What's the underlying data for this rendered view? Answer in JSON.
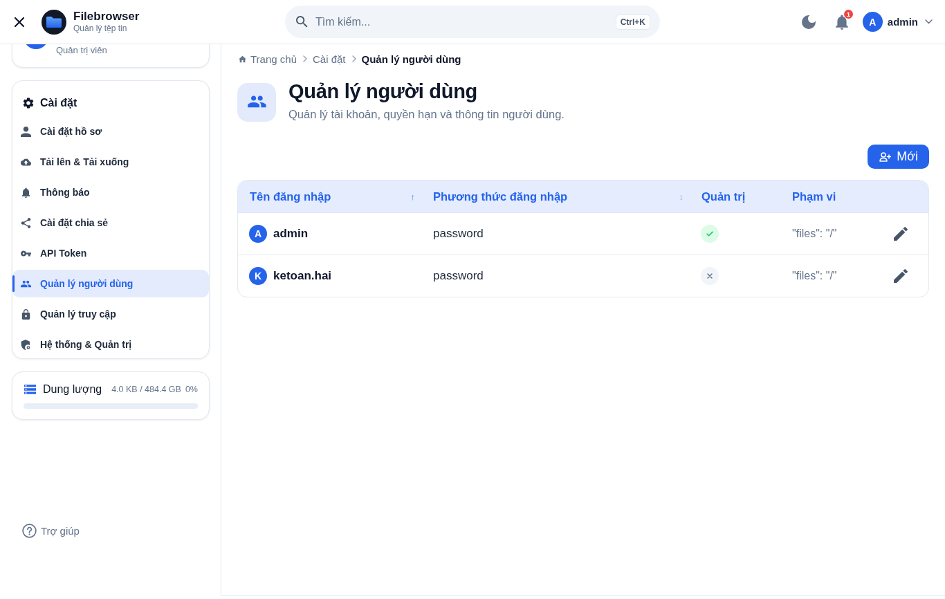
{
  "header": {
    "brand": {
      "name": "Filebrowser",
      "tagline": "Quản lý tệp tin"
    },
    "search": {
      "placeholder": "Tìm kiếm...",
      "shortcut": "Ctrl+K"
    },
    "notifications": {
      "count": "1"
    },
    "user": {
      "initial": "A",
      "name": "admin"
    }
  },
  "sidebar": {
    "profile": {
      "role": "Quản trị viên"
    },
    "settings": {
      "title": "Cài đặt",
      "items": [
        {
          "label": "Cài đặt hồ sơ",
          "selected": false
        },
        {
          "label": "Tải lên & Tải xuống",
          "selected": false
        },
        {
          "label": "Thông báo",
          "selected": false
        },
        {
          "label": "Cài đặt chia sẻ",
          "selected": false
        },
        {
          "label": "API Token",
          "selected": false
        },
        {
          "label": "Quản lý người dùng",
          "selected": true
        },
        {
          "label": "Quản lý truy cập",
          "selected": false
        },
        {
          "label": "Hệ thống & Quản trị",
          "selected": false
        }
      ]
    },
    "storage": {
      "title": "Dung lượng",
      "usage": "4.0 KB / 484.4 GB",
      "percent": "0%",
      "level": 0
    },
    "help": {
      "label": "Trợ giúp"
    }
  },
  "breadcrumb": [
    {
      "label": "Trang chủ",
      "current": false
    },
    {
      "label": "Cài đặt",
      "current": false
    },
    {
      "label": "Quản lý người dùng",
      "current": true
    }
  ],
  "page": {
    "title": "Quản lý người dùng",
    "subtitle": "Quản lý tài khoản, quyền hạn và thông tin người dùng."
  },
  "new_button": {
    "label": "Mới"
  },
  "table": {
    "columns": [
      {
        "label": "Tên đăng nhập",
        "sort_indicator": "↑"
      },
      {
        "label": "Phương thức đăng nhập",
        "sort_indicator": "↕"
      },
      {
        "label": "Quản trị"
      },
      {
        "label": "Phạm vi"
      }
    ],
    "rows": [
      {
        "initial": "A",
        "username": "admin",
        "method": "password",
        "admin": true,
        "scope": "\"files\": \"/\""
      },
      {
        "initial": "K",
        "username": "ketoan.hai",
        "method": "password",
        "admin": false,
        "scope": "\"files\": \"/\""
      }
    ]
  }
}
